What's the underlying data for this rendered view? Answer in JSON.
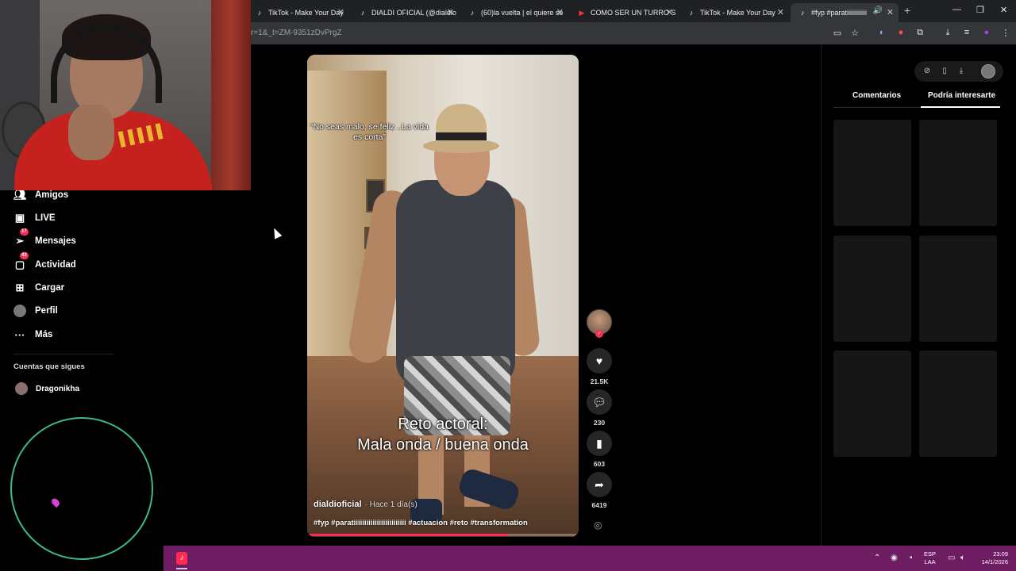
{
  "browser": {
    "tabs": [
      {
        "title": "TikTok - Make Your Day",
        "icon": "tiktok-icon"
      },
      {
        "title": "DIALDI OFICIAL (@dialdio",
        "icon": "tiktok-icon"
      },
      {
        "title": "(60)la vuelta | el quiere se",
        "icon": "tiktok-icon"
      },
      {
        "title": "COMO SER UN TURRO S",
        "icon": "youtube-icon"
      },
      {
        "title": "TikTok - Make Your Day",
        "icon": "tiktok-icon"
      },
      {
        "title": "#fyp #paratiiiiiiiiiiiiiiiii",
        "icon": "tiktok-icon",
        "active": true
      }
    ],
    "url": "r=1&_t=ZM-9351zDvPrgZ"
  },
  "sidebar": {
    "items": [
      {
        "label": "Amigos",
        "icon": "friends-icon"
      },
      {
        "label": "LIVE",
        "icon": "live-icon"
      },
      {
        "label": "Mensajes",
        "icon": "messages-icon",
        "badge": "17"
      },
      {
        "label": "Actividad",
        "icon": "activity-icon",
        "badge": "43"
      },
      {
        "label": "Cargar",
        "icon": "upload-icon"
      },
      {
        "label": "Perfil",
        "icon": "profile-avatar"
      },
      {
        "label": "Más",
        "icon": "more-icon"
      }
    ],
    "following_title": "Cuentas que sigues",
    "following": [
      {
        "name": "Dragonikha"
      }
    ]
  },
  "video": {
    "quote": "“No seas malo, se feliz ..La vida es corta”",
    "caption_line1": "Reto actoral:",
    "caption_line2": "Mala onda / buena onda",
    "author": "dialdioficial",
    "posted": "· Hace 1 día(s)",
    "hashtags": "#fyp #paratiiiiiiiiiiiiiiiiiiiiiiiii #actuacion #reto #transformation",
    "progress": 0.74
  },
  "actions": {
    "likes": "21.5K",
    "comments": "230",
    "saves": "603",
    "shares": "6419"
  },
  "right_panel": {
    "tab_comments": "Comentarios",
    "tab_interest": "Podría interesarte",
    "active_tab": "Podría interesarte"
  },
  "taskbar": {
    "lang_line1": "ESP",
    "lang_line2": "LAA",
    "time": "23:09",
    "date": "14/1/2026"
  },
  "colors": {
    "accent": "#fe2c55",
    "taskbar": "#6e1d63",
    "ring": "#3db79a"
  }
}
